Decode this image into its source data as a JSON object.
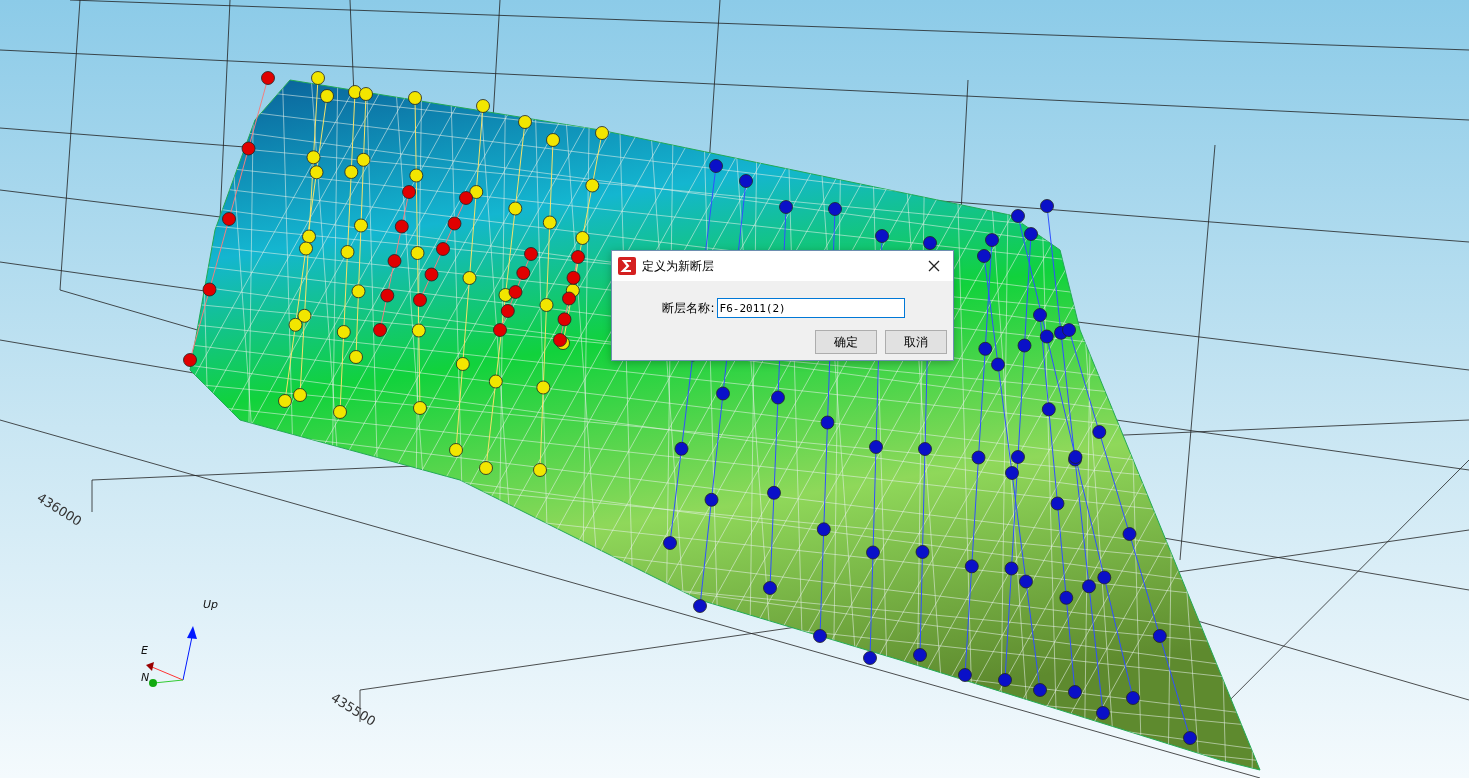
{
  "scene": {
    "axis_labels": [
      {
        "text": "436000"
      },
      {
        "text": "435500"
      }
    ],
    "orientation": {
      "up": "Up",
      "east": "E",
      "north": "N"
    }
  },
  "dialog": {
    "title": "定义为新断层",
    "field_label": "断层名称:",
    "field_value": "F6-2011(2)",
    "buttons": [
      {
        "label": "确定"
      },
      {
        "label": "取消"
      }
    ]
  }
}
